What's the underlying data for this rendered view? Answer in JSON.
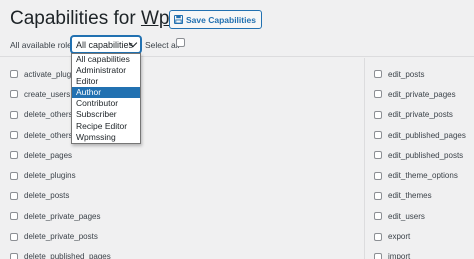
{
  "header": {
    "title_prefix": "Capabilities for",
    "site_name": "Wpmssing",
    "save_label": "Save Capabilities"
  },
  "filters": {
    "roles_label": "All available roles",
    "roles_selected": "All capabilities",
    "select_all_label": "Select all"
  },
  "dropdown": {
    "options": [
      "All capabilities",
      "Administrator",
      "Editor",
      "Author",
      "Contributor",
      "Subscriber",
      "Recipe Editor",
      "Wpmssing"
    ],
    "highlighted": "Author"
  },
  "capabilities_left": [
    "activate_plugins",
    "create_users",
    "delete_others_",
    "delete_others_",
    "delete_pages",
    "delete_plugins",
    "delete_posts",
    "delete_private_pages",
    "delete_private_posts",
    "delete_published_pages"
  ],
  "capabilities_right": [
    "edit_posts",
    "edit_private_pages",
    "edit_private_posts",
    "edit_published_pages",
    "edit_published_posts",
    "edit_theme_options",
    "edit_themes",
    "edit_users",
    "export",
    "import"
  ]
}
